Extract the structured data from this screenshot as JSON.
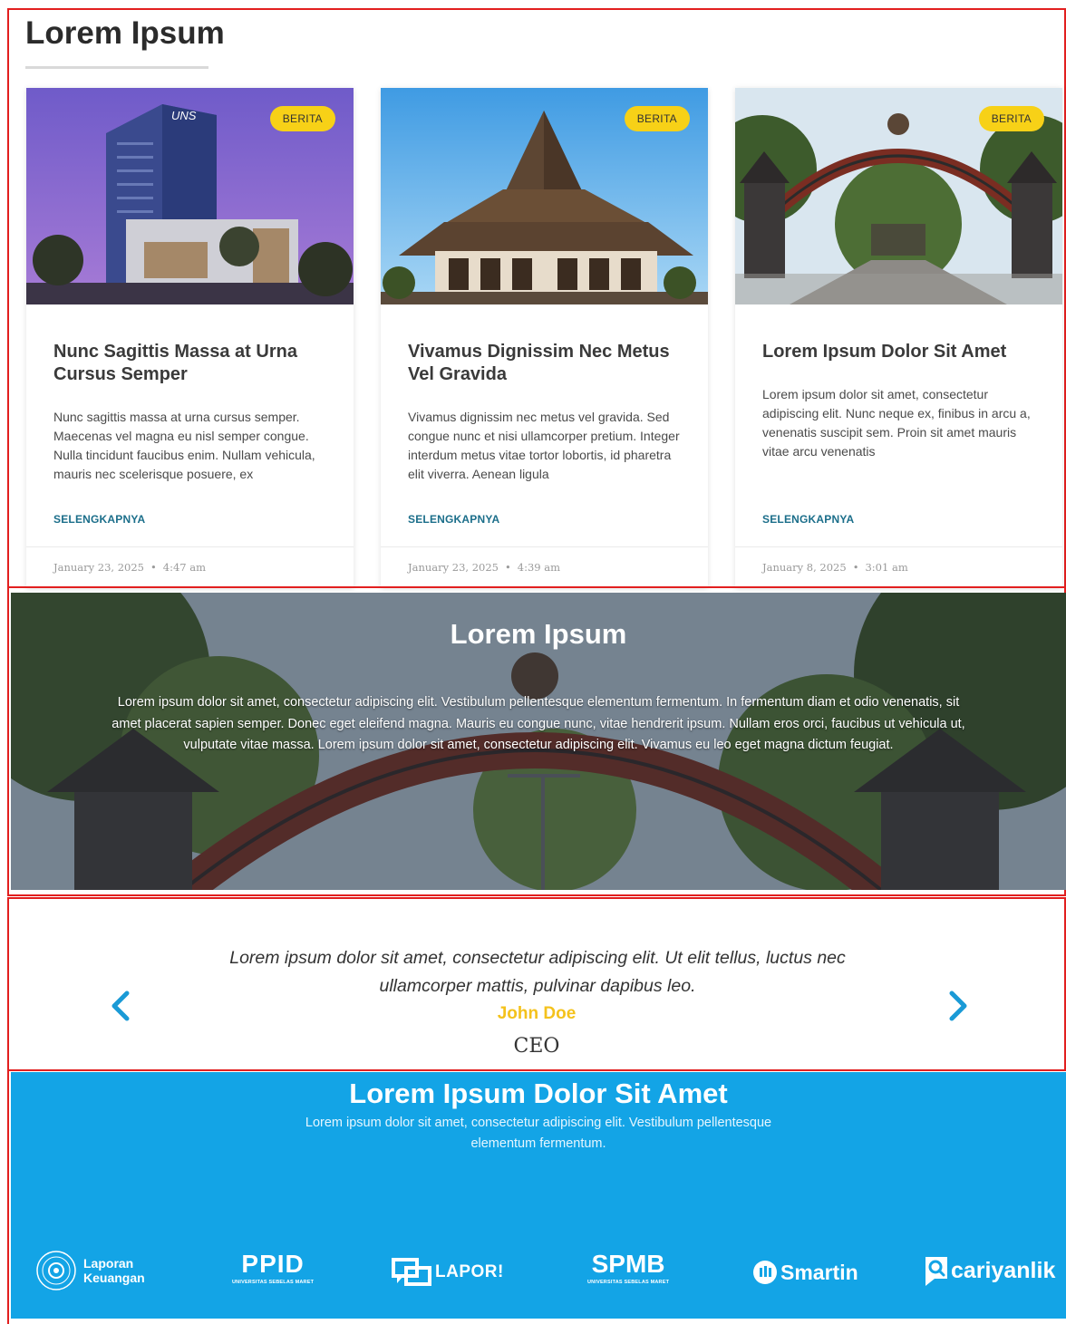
{
  "news": {
    "title": "Lorem Ipsum",
    "cards": [
      {
        "badge": "BERITA",
        "title": "Nunc Sagittis Massa at Urna Cursus Semper",
        "excerpt": "Nunc sagittis massa at urna cursus semper. Maecenas vel magna eu nisl semper congue. Nulla tincidunt faucibus enim. Nullam vehicula, mauris nec scelerisque posuere, ex",
        "more": "SELENGKAPNYA",
        "date": "January 23, 2025",
        "time": "4:47 am"
      },
      {
        "badge": "BERITA",
        "title": "Vivamus Dignissim Nec Metus Vel Gravida",
        "excerpt": "Vivamus dignissim nec metus vel gravida. Sed congue nunc et nisi ullamcorper pretium. Integer interdum metus vitae tortor lobortis, id pharetra elit viverra. Aenean ligula",
        "more": "SELENGKAPNYA",
        "date": "January 23, 2025",
        "time": "4:39 am"
      },
      {
        "badge": "BERITA",
        "title": "Lorem Ipsum Dolor Sit Amet",
        "excerpt": "Lorem ipsum dolor sit amet, consectetur adipiscing elit. Nunc neque ex, finibus in arcu a, venenatis suscipit sem. Proin sit amet mauris vitae arcu venenatis",
        "more": "SELENGKAPNYA",
        "date": "January 8, 2025",
        "time": "3:01 am"
      }
    ]
  },
  "hero": {
    "title": "Lorem Ipsum",
    "text": "Lorem ipsum dolor sit amet, consectetur adipiscing elit. Vestibulum pellentesque elementum fermentum. In fermentum diam et odio venenatis, sit amet placerat sapien semper. Donec eget eleifend magna. Mauris eu congue nunc, vitae hendrerit ipsum. Nullam eros orci, faucibus ut vehicula ut, vulputate vitae massa. Lorem ipsum dolor sit amet, consectetur adipiscing elit. Vivamus eu leo eget magna dictum feugiat."
  },
  "testimonial": {
    "quote": "Lorem ipsum dolor sit amet, consectetur adipiscing elit. Ut elit tellus, luctus nec ullamcorper mattis, pulvinar dapibus leo.",
    "name": "John Doe",
    "role": "CEO",
    "prev_icon": "chevron-left-icon",
    "next_icon": "chevron-right-icon"
  },
  "links": {
    "title": "Lorem Ipsum Dolor Sit Amet",
    "subtitle": "Lorem ipsum dolor sit amet, consectetur adipiscing elit. Vestibulum pellentesque elementum fermentum.",
    "logos": {
      "laporan_line1": "Laporan",
      "laporan_line2": "Keuangan",
      "ppid": "PPID",
      "ppid_sub": "UNIVERSITAS SEBELAS MARET",
      "lapor": "LAPOR!",
      "spmb": "SPMB",
      "spmb_sub": "UNIVERSITAS SEBELAS MARET",
      "smartin": "Smartin",
      "cariyanlik": "cariyanlik"
    }
  },
  "colors": {
    "badge": "#f7d117",
    "link": "#1b6e8a",
    "accent_blue": "#13a4e6",
    "arrow": "#1a9ad6",
    "name": "#f4c21c"
  }
}
